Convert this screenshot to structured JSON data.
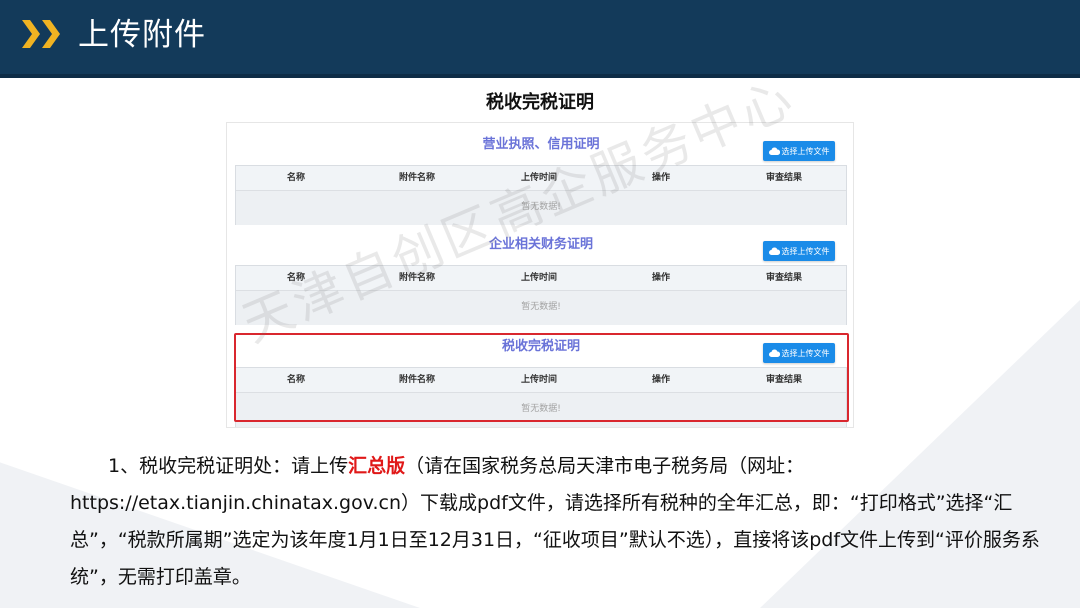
{
  "header": {
    "title": "上传附件"
  },
  "screenshot": {
    "title": "税收完税证明",
    "sections": [
      {
        "title": "营业执照、信用证明",
        "upload_label": "选择上传文件",
        "columns": [
          "名称",
          "附件名称",
          "上传时间",
          "操作",
          "审查结果"
        ],
        "empty_text": "暂无数据!"
      },
      {
        "title": "企业相关财务证明",
        "upload_label": "选择上传文件",
        "columns": [
          "名称",
          "附件名称",
          "上传时间",
          "操作",
          "审查结果"
        ],
        "empty_text": "暂无数据!"
      },
      {
        "title": "税收完税证明",
        "upload_label": "选择上传文件",
        "columns": [
          "名称",
          "附件名称",
          "上传时间",
          "操作",
          "审查结果"
        ],
        "empty_text": "暂无数据!"
      }
    ],
    "watermark": "天津自创区高企服务中心"
  },
  "instructions": {
    "part1": "1、税收完税证明处：请上传",
    "highlight": "汇总版",
    "part2": "（请在国家税务总局天津市电子税务局（网址：https://etax.tianjin.chinatax.gov.cn）下载成pdf文件，请选择所有税种的全年汇总，即：“打印格式”选择“汇总”，“税款所属期”选定为该年度1月1日至12月31日，“征收项目”默认不选），直接将该pdf文件上传到“评价服务系统”，无需打印盖章。"
  },
  "colors": {
    "header_bg": "#133a5a",
    "accent": "#f0b322",
    "section_title": "#6a73d8",
    "button": "#1a8be8",
    "highlight_border": "#d9272e",
    "highlight_text": "#e01818"
  }
}
